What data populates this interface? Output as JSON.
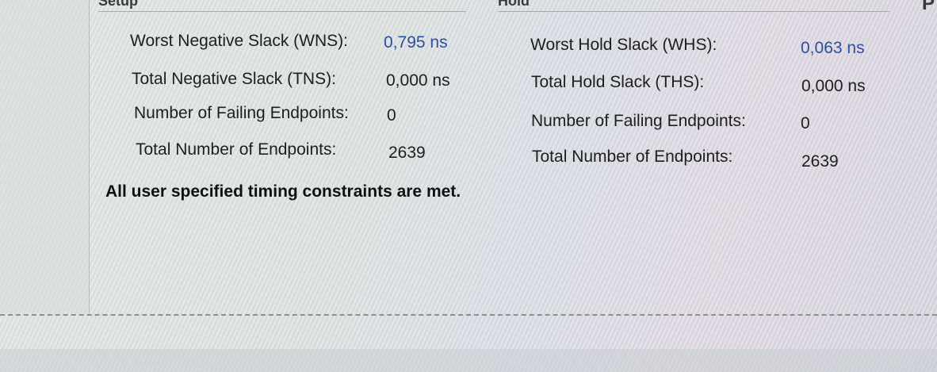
{
  "setup": {
    "header": "Setup",
    "rows": [
      {
        "label": "Worst Negative Slack (WNS):",
        "value": "0,795 ns"
      },
      {
        "label": "Total Negative Slack (TNS):",
        "value": "0,000 ns"
      },
      {
        "label": "Number of Failing Endpoints:",
        "value": "0"
      },
      {
        "label": "Total Number of Endpoints:",
        "value": "2639"
      }
    ],
    "status": "All user specified timing constraints are met."
  },
  "hold": {
    "header": "Hold",
    "rows": [
      {
        "label": "Worst Hold Slack (WHS):",
        "value": "0,063 ns"
      },
      {
        "label": "Total Hold Slack (THS):",
        "value": "0,000 ns"
      },
      {
        "label": "Number of Failing Endpoints:",
        "value": "0"
      },
      {
        "label": "Total Number of Endpoints:",
        "value": "2639"
      }
    ]
  },
  "pulse_width": {
    "header": "P"
  },
  "colors": {
    "link": "#2c4f9e",
    "text": "#1e1e1e"
  }
}
